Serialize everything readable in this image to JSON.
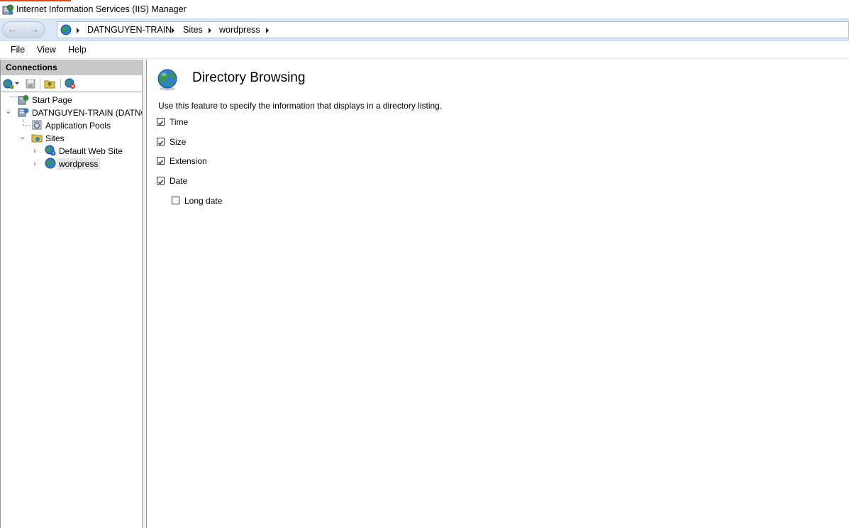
{
  "window": {
    "title": "Internet Information Services (IIS) Manager"
  },
  "address": {
    "crumbs": [
      "DATNGUYEN-TRAIN",
      "Sites",
      "wordpress"
    ]
  },
  "menu": {
    "file": "File",
    "view": "View",
    "help": "Help"
  },
  "connections": {
    "header": "Connections",
    "tree": {
      "start_page": "Start Page",
      "server": "DATNGUYEN-TRAIN (DATNG",
      "app_pools": "Application Pools",
      "sites": "Sites",
      "default_site": "Default Web Site",
      "wordpress": "wordpress"
    }
  },
  "feature": {
    "title": "Directory Browsing",
    "description": "Use this feature to specify the information that displays in a directory listing.",
    "options": [
      {
        "label": "Time",
        "checked": true
      },
      {
        "label": "Size",
        "checked": true
      },
      {
        "label": "Extension",
        "checked": true
      },
      {
        "label": "Date",
        "checked": true
      },
      {
        "label": "Long date",
        "checked": false
      }
    ]
  },
  "colors": {
    "accent": "#e6461e",
    "addressbar": "#dbe7f6",
    "pane_header": "#c8c8c8"
  }
}
